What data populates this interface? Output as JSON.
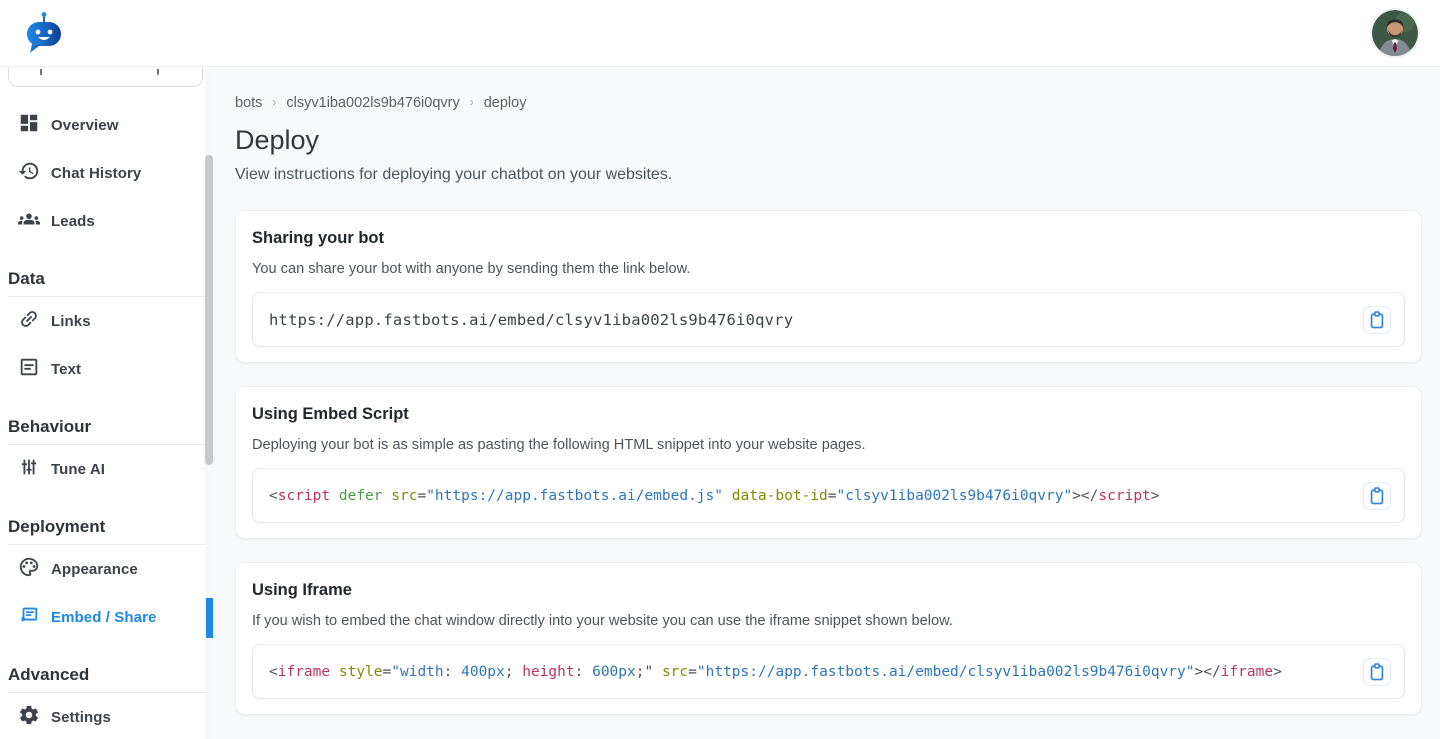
{
  "header": {
    "logo": "fastbots-robot-logo",
    "avatar": "user-profile-photo"
  },
  "sidebar": {
    "items": [
      {
        "label": "Overview",
        "icon": "dashboard-icon"
      },
      {
        "label": "Chat History",
        "icon": "history-icon"
      },
      {
        "label": "Leads",
        "icon": "people-icon"
      }
    ],
    "sections": [
      {
        "title": "Data",
        "items": [
          {
            "label": "Links",
            "icon": "link-icon"
          },
          {
            "label": "Text",
            "icon": "document-icon"
          }
        ]
      },
      {
        "title": "Behaviour",
        "items": [
          {
            "label": "Tune AI",
            "icon": "tune-icon"
          }
        ]
      },
      {
        "title": "Deployment",
        "items": [
          {
            "label": "Appearance",
            "icon": "palette-icon"
          },
          {
            "label": "Embed / Share",
            "icon": "embed-icon",
            "active": true
          }
        ]
      },
      {
        "title": "Advanced",
        "items": [
          {
            "label": "Settings",
            "icon": "gear-icon"
          }
        ]
      }
    ]
  },
  "breadcrumb": {
    "items": [
      "bots",
      "clsyv1iba002ls9b476i0qvry",
      "deploy"
    ],
    "separator": "›"
  },
  "page": {
    "title": "Deploy",
    "subtitle": "View instructions for deploying your chatbot on your websites."
  },
  "cards": [
    {
      "title": "Sharing your bot",
      "description": "You can share your bot with anyone by sending them the link below.",
      "copy_icon": "clipboard-icon",
      "code_tokens": [
        {
          "t": "https://app.fastbots.ai/embed/clsyv1iba002ls9b476i0qvry",
          "c": "pln"
        }
      ]
    },
    {
      "title": "Using Embed Script",
      "description": "Deploying your bot is as simple as pasting the following HTML snippet into your website pages.",
      "copy_icon": "clipboard-icon",
      "code_tokens": [
        {
          "t": "<",
          "c": "pun"
        },
        {
          "t": "script",
          "c": "tag"
        },
        {
          "t": " ",
          "c": "pln"
        },
        {
          "t": "defer",
          "c": "kw"
        },
        {
          "t": " ",
          "c": "pln"
        },
        {
          "t": "src",
          "c": "atr"
        },
        {
          "t": "=",
          "c": "pun"
        },
        {
          "t": "\"https://app.fastbots.ai/embed.js\"",
          "c": "str"
        },
        {
          "t": " ",
          "c": "pln"
        },
        {
          "t": "data-bot-id",
          "c": "atr"
        },
        {
          "t": "=",
          "c": "pun"
        },
        {
          "t": "\"clsyv1iba002ls9b476i0qvry\"",
          "c": "str"
        },
        {
          "t": "></",
          "c": "pun"
        },
        {
          "t": "script",
          "c": "tag"
        },
        {
          "t": ">",
          "c": "pun"
        }
      ]
    },
    {
      "title": "Using Iframe",
      "description": "If you wish to embed the chat window directly into your website you can use the iframe snippet shown below.",
      "copy_icon": "clipboard-icon",
      "code_tokens": [
        {
          "t": "<",
          "c": "pun"
        },
        {
          "t": "iframe",
          "c": "tag"
        },
        {
          "t": " ",
          "c": "pln"
        },
        {
          "t": "style",
          "c": "atr"
        },
        {
          "t": "=",
          "c": "pun"
        },
        {
          "t": "\"width",
          "c": "str"
        },
        {
          "t": ": ",
          "c": "pun"
        },
        {
          "t": "400px",
          "c": "str"
        },
        {
          "t": "; ",
          "c": "pun"
        },
        {
          "t": "height",
          "c": "tag"
        },
        {
          "t": ": ",
          "c": "pun"
        },
        {
          "t": "600px",
          "c": "str"
        },
        {
          "t": ";\"",
          "c": "pun"
        },
        {
          "t": " ",
          "c": "pln"
        },
        {
          "t": "src",
          "c": "atr"
        },
        {
          "t": "=",
          "c": "pun"
        },
        {
          "t": "\"https://app.fastbots.ai/embed/clsyv1iba002ls9b476i0qvry\"",
          "c": "str"
        },
        {
          "t": "></",
          "c": "pun"
        },
        {
          "t": "iframe",
          "c": "tag"
        },
        {
          "t": ">",
          "c": "pun"
        }
      ]
    }
  ],
  "colors": {
    "accent_blue": "#1e88e5",
    "main_background": "#f8f9fa",
    "card_background": "#ffffff",
    "syntax_tag": "#b93566",
    "syntax_attribute": "#7f8c00",
    "syntax_keyword": "#479d43",
    "syntax_string": "#2f76b5",
    "syntax_plain": "#3d4247"
  }
}
